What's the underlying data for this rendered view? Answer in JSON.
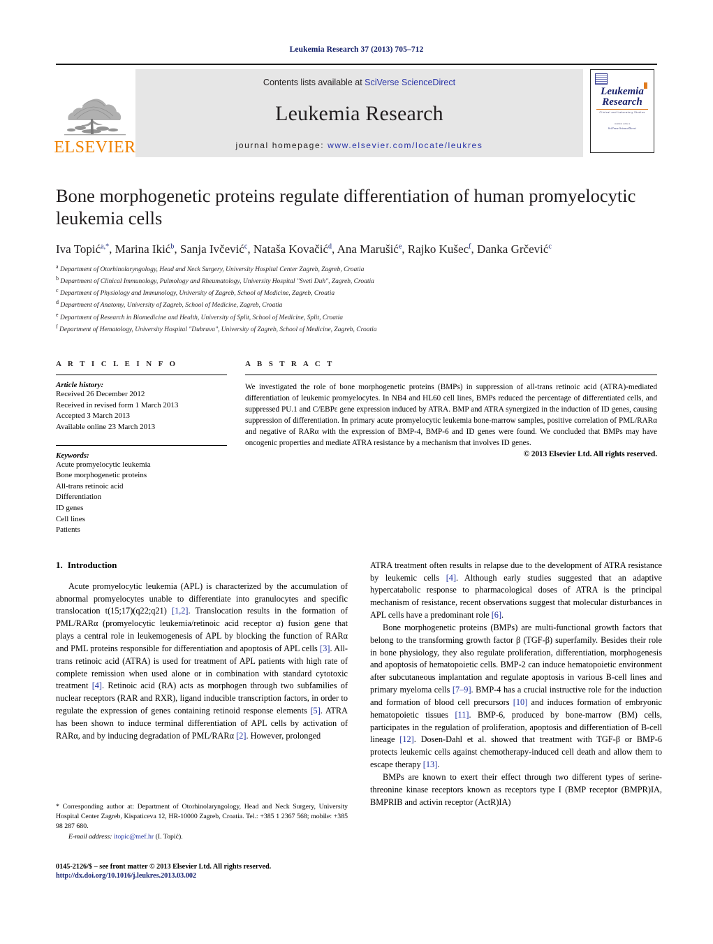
{
  "running_head": "Leukemia Research 37 (2013) 705–712",
  "masthead": {
    "publisher_name": "ELSEVIER",
    "contents_prefix": "Contents lists available at ",
    "contents_link": "SciVerse ScienceDirect",
    "journal_title": "Leukemia Research",
    "homepage_prefix": "journal homepage: ",
    "homepage_url": "www.elsevier.com/locate/leukres",
    "cover": {
      "line1": "Leukemia",
      "line2": "Research",
      "subtitle": "Clinical and Laboratory Studies",
      "mini_label": "Available online at",
      "mini_label2": "SciVerse ScienceDirect"
    }
  },
  "article": {
    "title": "Bone morphogenetic proteins regulate differentiation of human promyelocytic leukemia cells",
    "authors": [
      {
        "name": "Iva Topić",
        "sup": "a,*"
      },
      {
        "name": "Marina Ikić",
        "sup": "b"
      },
      {
        "name": "Sanja Ivčević",
        "sup": "c"
      },
      {
        "name": "Nataša Kovačić",
        "sup": "d"
      },
      {
        "name": "Ana Marušić",
        "sup": "e"
      },
      {
        "name": "Rajko Kušec",
        "sup": "f"
      },
      {
        "name": "Danka Grčević",
        "sup": "c"
      }
    ],
    "affiliations": [
      {
        "marker": "a",
        "text": "Department of Otorhinolaryngology, Head and Neck Surgery, University Hospital Center Zagreb, Zagreb, Croatia"
      },
      {
        "marker": "b",
        "text": "Department of Clinical Immunology, Pulmology and Rheumatology, University Hospital \"Sveti Duh\", Zagreb, Croatia"
      },
      {
        "marker": "c",
        "text": "Department of Physiology and Immunology, University of Zagreb, School of Medicine, Zagreb, Croatia"
      },
      {
        "marker": "d",
        "text": "Department of Anatomy, University of Zagreb, School of Medicine, Zagreb, Croatia"
      },
      {
        "marker": "e",
        "text": "Department of Research in Biomedicine and Health, University of Split, School of Medicine, Split, Croatia"
      },
      {
        "marker": "f",
        "text": "Department of Hematology, University Hospital \"Dubrava\", University of Zagreb, School of Medicine, Zagreb, Croatia"
      }
    ]
  },
  "article_info": {
    "heading": "A R T I C L E  I N F O",
    "history_title": "Article history:",
    "history": [
      "Received 26 December 2012",
      "Received in revised form 1 March 2013",
      "Accepted 3 March 2013",
      "Available online 23 March 2013"
    ],
    "keywords_title": "Keywords:",
    "keywords": [
      "Acute promyelocytic leukemia",
      "Bone morphogenetic proteins",
      "All-trans retinoic acid",
      "Differentiation",
      "ID genes",
      "Cell lines",
      "Patients"
    ]
  },
  "abstract": {
    "heading": "A B S T R A C T",
    "text": "We investigated the role of bone morphogenetic proteins (BMPs) in suppression of all-trans retinoic acid (ATRA)-mediated differentiation of leukemic promyelocytes. In NB4 and HL60 cell lines, BMPs reduced the percentage of differentiated cells, and suppressed PU.1 and C/EBPε gene expression induced by ATRA. BMP and ATRA synergized in the induction of ID genes, causing suppression of differentiation. In primary acute promyelocytic leukemia bone-marrow samples, positive correlation of PML/RARα and negative of RARα with the expression of BMP-4, BMP-6 and ID genes were found. We concluded that BMPs may have oncogenic properties and mediate ATRA resistance by a mechanism that involves ID genes.",
    "copyright": "© 2013 Elsevier Ltd. All rights reserved."
  },
  "introduction": {
    "number": "1.",
    "heading": "Introduction",
    "left_para_1": "Acute promyelocytic leukemia (APL) is characterized by the accumulation of abnormal promyelocytes unable to differentiate into granulocytes and specific translocation t(15;17)(q22;q21) [1,2]. Translocation results in the formation of PML/RARα (promyelocytic leukemia/retinoic acid receptor α) fusion gene that plays a central role in leukemogenesis of APL by blocking the function of RARα and PML proteins responsible for differentiation and apoptosis of APL cells [3]. All-trans retinoic acid (ATRA) is used for treatment of APL patients with high rate of complete remission when used alone or in combination with standard cytotoxic treatment [4]. Retinoic acid (RA) acts as morphogen through two subfamilies of nuclear receptors (RAR and RXR), ligand inducible transcription factors, in order to regulate the expression of genes containing retinoid response elements [5]. ATRA has been shown to induce terminal differentiation of APL cells by activation of RARα, and by inducing degradation of PML/RARα [2]. However, prolonged",
    "right_para_1": "ATRA treatment often results in relapse due to the development of ATRA resistance by leukemic cells [4]. Although early studies suggested that an adaptive hypercatabolic response to pharmacological doses of ATRA is the principal mechanism of resistance, recent observations suggest that molecular disturbances in APL cells have a predominant role [6].",
    "right_para_2": "Bone morphogenetic proteins (BMPs) are multi-functional growth factors that belong to the transforming growth factor β (TGF-β) superfamily. Besides their role in bone physiology, they also regulate proliferation, differentiation, morphogenesis and apoptosis of hematopoietic cells. BMP-2 can induce hematopoietic environment after subcutaneous implantation and regulate apoptosis in various B-cell lines and primary myeloma cells [7–9]. BMP-4 has a crucial instructive role for the induction and formation of blood cell precursors [10] and induces formation of embryonic hematopoietic tissues [11]. BMP-6, produced by bone-marrow (BM) cells, participates in the regulation of proliferation, apoptosis and differentiation of B-cell lineage [12]. Dosen-Dahl et al. showed that treatment with TGF-β or BMP-6 protects leukemic cells against chemotherapy-induced cell death and allow them to escape therapy [13].",
    "right_para_3": "BMPs are known to exert their effect through two different types of serine-threonine kinase receptors known as receptors type I (BMP receptor (BMPR)IA, BMPRIB and activin receptor (ActR)IA)"
  },
  "footnote": {
    "corresponding": "* Corresponding author at: Department of Otorhinolaryngology, Head and Neck Surgery, University Hospital Center Zagreb, Kispaticeva 12, HR-10000 Zagreb, Croatia. Tel.: +385 1 2367 568; mobile: +385 98 287 680.",
    "email_label": "E-mail address:",
    "email": "itopic@mef.hr",
    "email_owner": "(I. Topić)."
  },
  "imprint": {
    "issn_line": "0145-2126/$ – see front matter © 2013 Elsevier Ltd. All rights reserved.",
    "doi": "http://dx.doi.org/10.1016/j.leukres.2013.03.002"
  }
}
